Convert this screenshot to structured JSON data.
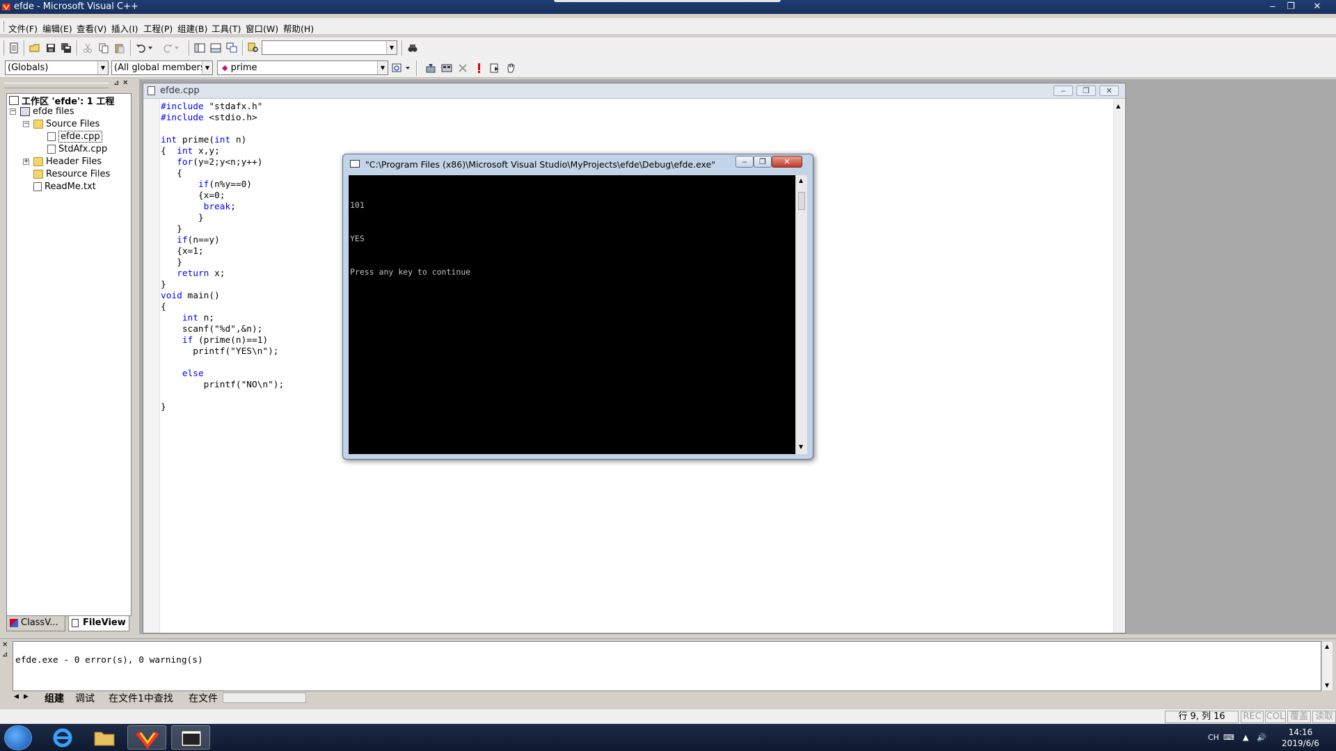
{
  "window": {
    "title": "efde - Microsoft Visual C++",
    "minimize_glyph": "‒",
    "restore_glyph": "❐",
    "close_glyph": "✕"
  },
  "menu": [
    "文件(F)",
    "编辑(E)",
    "查看(V)",
    "插入(I)",
    "工程(P)",
    "组建(B)",
    "工具(T)",
    "窗口(W)",
    "帮助(H)"
  ],
  "toolbar": {
    "find_combo_value": "",
    "scope_combo": "(Globals)",
    "members_combo": "(All global members",
    "function_combo": "prime"
  },
  "workspace": {
    "root": "工作区 'efde': 1 工程",
    "project": "efde files",
    "source_folder": "Source Files",
    "files": [
      "efde.cpp",
      "StdAfx.cpp"
    ],
    "header_folder": "Header Files",
    "resource_folder": "Resource Files",
    "readme": "ReadMe.txt",
    "tabs": [
      "ClassV...",
      "FileView"
    ]
  },
  "editor": {
    "document": "efde.cpp",
    "code_lines": [
      "#include \"stdafx.h\"",
      "#include <stdio.h>",
      "",
      "int prime(int n)",
      "{  int x,y;",
      "   for(y=2;y<n;y++)",
      "   {",
      "       if(n%y==0)",
      "       {x=0;",
      "        break;",
      "       }",
      "   }",
      "   if(n==y)",
      "   {x=1;",
      "   }",
      "   return x;",
      "}",
      "void main()",
      "{",
      "    int n;",
      "    scanf(\"%d\",&n);",
      "    if (prime(n)==1)",
      "      printf(\"YES\\n\");",
      "",
      "    else",
      "        printf(\"NO\\n\");",
      "",
      "}"
    ]
  },
  "console": {
    "title": "\"C:\\Program Files (x86)\\Microsoft Visual Studio\\MyProjects\\efde\\Debug\\efde.exe\"",
    "output_lines": [
      "101",
      "YES",
      "Press any key to continue"
    ]
  },
  "output": {
    "message": "efde.exe - 0 error(s), 0 warning(s)",
    "tabs": [
      "组建",
      "调试",
      "在文件1中查找",
      "在文件"
    ]
  },
  "status": {
    "position": "行 9, 列 16",
    "indicators": [
      "REC",
      "COL",
      "覆盖",
      "读取"
    ]
  },
  "taskbar": {
    "lang": "CH",
    "time": "14:16",
    "date": "2019/6/6"
  },
  "colors": {
    "keyword": "#0000ff",
    "console_bg": "#000000",
    "console_text": "#c0c0c0"
  }
}
